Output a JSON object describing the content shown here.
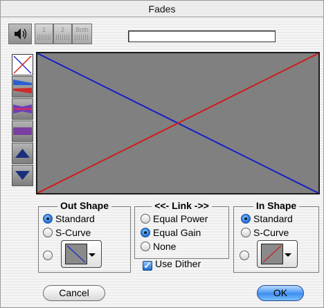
{
  "window": {
    "title": "Fades"
  },
  "toolbar": {
    "speaker_icon": "speaker-icon",
    "channel_buttons": [
      {
        "label": "1"
      },
      {
        "label": "2"
      },
      {
        "label": "Both"
      }
    ],
    "progress_fraction": 0
  },
  "tools": [
    {
      "icon": "crossfade-x-icon",
      "active": true
    },
    {
      "icon": "fade-out-waveform-icon",
      "active": false
    },
    {
      "icon": "fade-in-out-waveform-icon",
      "active": false
    },
    {
      "icon": "flat-waveform-icon",
      "active": false
    },
    {
      "icon": "triangle-up-icon",
      "active": false
    },
    {
      "icon": "triangle-down-icon",
      "active": false
    }
  ],
  "graph": {
    "fade_out_color": "#1a1acc",
    "fade_in_color": "#d01a1a",
    "background": "#808080"
  },
  "out_shape": {
    "title": "Out Shape",
    "options": [
      {
        "label": "Standard",
        "selected": true
      },
      {
        "label": "S-Curve",
        "selected": false
      }
    ],
    "custom_selected": false
  },
  "link": {
    "title": "<<- Link ->>",
    "options": [
      {
        "label": "Equal Power",
        "selected": false
      },
      {
        "label": "Equal Gain",
        "selected": true
      },
      {
        "label": "None",
        "selected": false
      }
    ]
  },
  "in_shape": {
    "title": "In Shape",
    "options": [
      {
        "label": "Standard",
        "selected": true
      },
      {
        "label": "S-Curve",
        "selected": false
      }
    ],
    "custom_selected": false
  },
  "dither": {
    "label": "Use Dither",
    "checked": true
  },
  "buttons": {
    "cancel": "Cancel",
    "ok": "OK"
  }
}
